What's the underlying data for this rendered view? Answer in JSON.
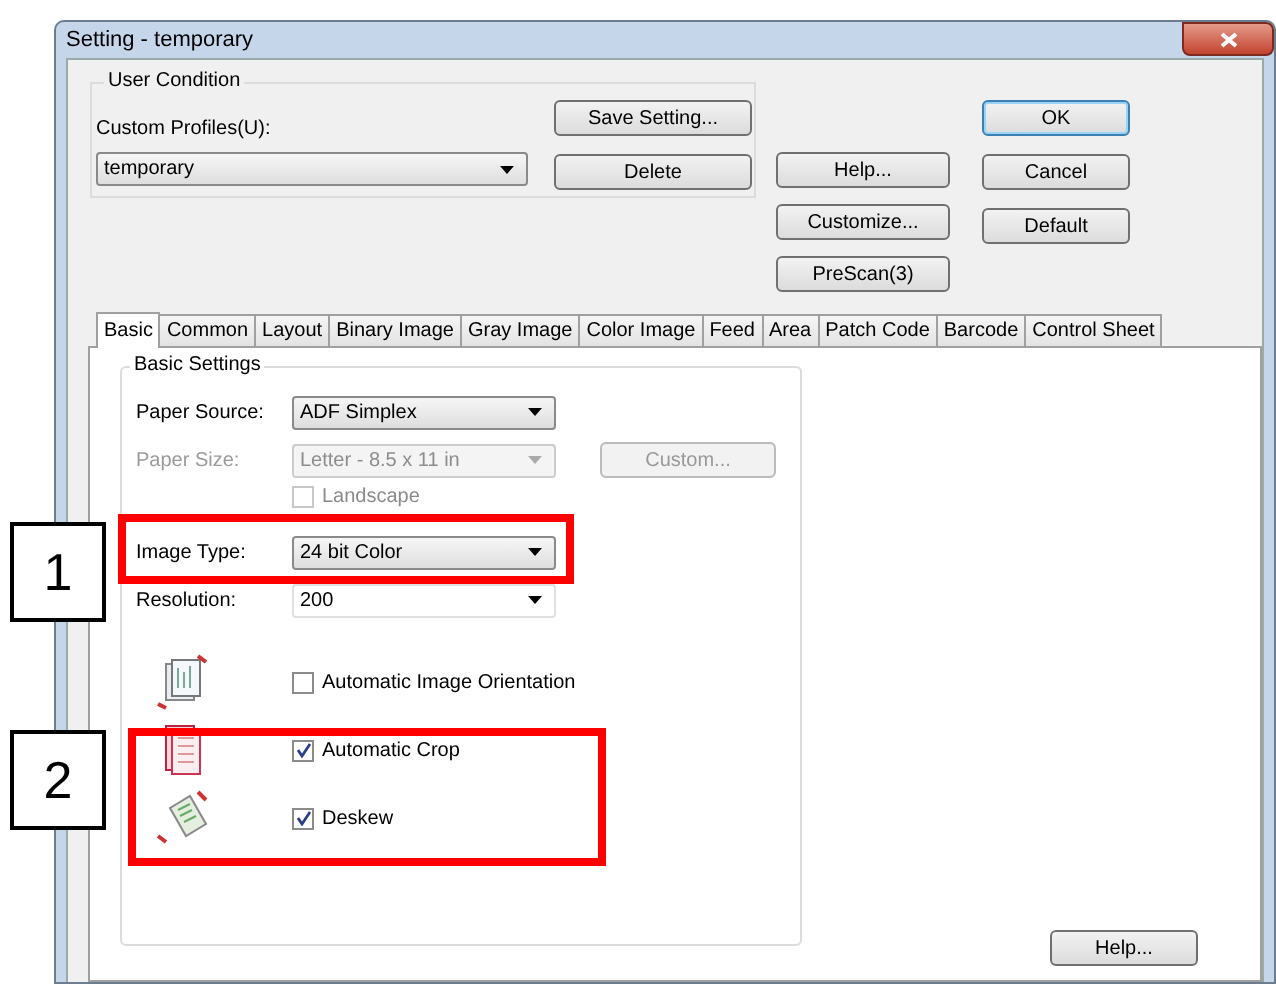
{
  "window": {
    "title": "Setting - temporary"
  },
  "user_condition": {
    "title": "User Condition",
    "profile_label": "Custom Profiles(U):",
    "profile_value": "temporary",
    "buttons": [
      "Save Setting...",
      "Delete"
    ]
  },
  "middle_buttons": [
    "Help...",
    "Customize...",
    "PreScan(3)"
  ],
  "dialog_buttons": [
    {
      "label": "OK",
      "default": true
    },
    {
      "label": "Cancel",
      "default": false
    },
    {
      "label": "Default",
      "default": false
    }
  ],
  "tabs": [
    {
      "label": "Basic",
      "selected": true
    },
    {
      "label": "Common",
      "selected": false
    },
    {
      "label": "Layout",
      "selected": false
    },
    {
      "label": "Binary Image",
      "selected": false
    },
    {
      "label": "Gray Image",
      "selected": false
    },
    {
      "label": "Color Image",
      "selected": false
    },
    {
      "label": "Feed",
      "selected": false
    },
    {
      "label": "Area",
      "selected": false
    },
    {
      "label": "Patch Code",
      "selected": false
    },
    {
      "label": "Barcode",
      "selected": false
    },
    {
      "label": "Control Sheet",
      "selected": false
    }
  ],
  "basic_settings": {
    "title": "Basic Settings",
    "rows": [
      {
        "kind": "select",
        "label": "Paper Source:",
        "value": "ADF Simplex",
        "disabled": false
      },
      {
        "kind": "select",
        "label": "Paper Size:",
        "value": "Letter - 8.5 x 11 in",
        "disabled": true,
        "button": "Custom..."
      },
      {
        "kind": "checkbox",
        "label": "Landscape",
        "checked": false,
        "disabled": true
      },
      {
        "kind": "select",
        "label": "Image Type:",
        "value": "24 bit Color",
        "disabled": false
      },
      {
        "kind": "combo",
        "label": "Resolution:",
        "value": "200",
        "disabled": false
      },
      {
        "kind": "icon-checkbox",
        "label": "Automatic Image Orientation",
        "checked": false,
        "disabled": false
      },
      {
        "kind": "icon-checkbox",
        "label": "Automatic Crop",
        "checked": true,
        "disabled": false
      },
      {
        "kind": "icon-checkbox",
        "label": "Deskew",
        "checked": true,
        "disabled": false
      }
    ]
  },
  "panel_help": "Help...",
  "annotations": [
    {
      "label": "1"
    },
    {
      "label": "2"
    }
  ]
}
